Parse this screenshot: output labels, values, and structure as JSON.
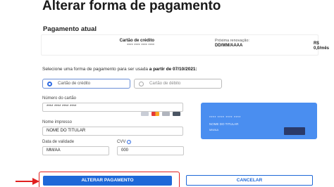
{
  "page": {
    "title": "Alterar forma de pagamento"
  },
  "current_plan": {
    "section_title": "Pagamento atual",
    "method_label": "Cartão de crédito",
    "method_masked": "**** **** **** ****",
    "renewal_label": "Próxima renovação:",
    "renewal_date": "DD/MM/AAAA",
    "price": "R$ 0,0/mês"
  },
  "select": {
    "text": "Selecione uma forma de pagamento para ser usada",
    "date_text": "a partir de 07/10/2021:",
    "options": [
      "Cartão de crédito",
      "Cartão de débito"
    ]
  },
  "form": {
    "card_number_label": "Número do cartão",
    "card_number_value": "**** **** **** ****",
    "name_label": "Nome impresso",
    "name_value": "NOME DO TITULAR",
    "expiry_label": "Data de validade",
    "expiry_value": "MM/AA",
    "cvv_label": "CVV",
    "cvv_value": "000"
  },
  "card_preview": {
    "number": "**** **** **** ****",
    "name": "NOME DO TITULAR",
    "expiry": "MM/AA"
  },
  "buttons": {
    "primary": "ALTERAR PAGAMENTO",
    "secondary": "CANCELAR"
  },
  "colors": {
    "accent": "#1e68d8",
    "card": "#4a8ef0",
    "highlight": "#e02020"
  },
  "icons": [
    "info-icon",
    "visa-icon",
    "mastercard-icon",
    "elo-icon",
    "amex-icon",
    "arrow-right-icon"
  ]
}
